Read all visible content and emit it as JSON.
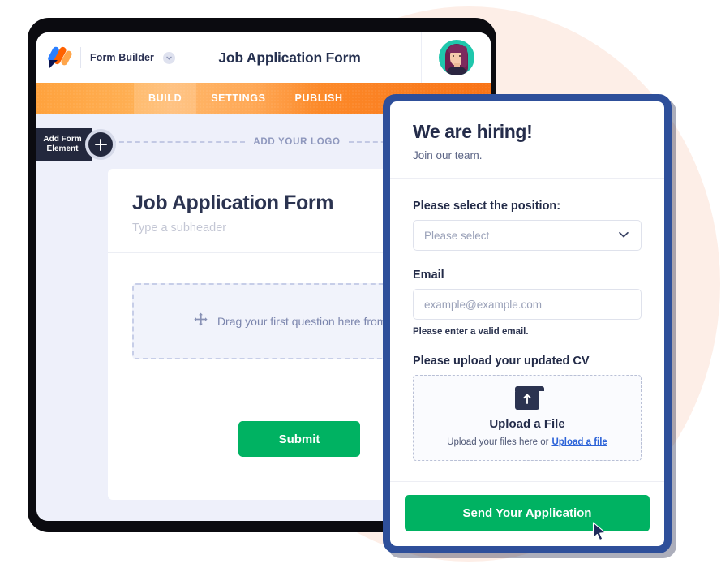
{
  "builder": {
    "brand": {
      "name": "Form Builder",
      "logo_icon": "jotform-logo-icon",
      "chevron_icon": "chevron-down-icon"
    },
    "form_title": "Job Application Form",
    "avatar_icon": "user-avatar",
    "tabs": [
      {
        "label": "BUILD",
        "active": true
      },
      {
        "label": "SETTINGS",
        "active": false
      },
      {
        "label": "PUBLISH",
        "active": false
      }
    ],
    "add_element": {
      "label_line1": "Add Form",
      "label_line2": "Element",
      "plus_icon": "plus-icon"
    },
    "logo_row_label": "ADD YOUR LOGO",
    "canvas": {
      "heading": "Job Application Form",
      "subheading": "Type a subheader",
      "drop_zone_label": "Drag your first question here from left",
      "drop_zone_icon": "move-arrows-icon",
      "submit_label": "Submit"
    }
  },
  "preview": {
    "title": "We are hiring!",
    "subtitle": "Join our team.",
    "fields": {
      "position": {
        "label": "Please select the position:",
        "value": "Please select",
        "chevron_icon": "chevron-down-icon"
      },
      "email": {
        "label": "Email",
        "placeholder": "example@example.com",
        "value": "",
        "error": "Please enter a valid email."
      },
      "cv": {
        "label": "Please upload your updated CV",
        "icon": "folder-upload-icon",
        "title": "Upload a File",
        "hint": "Upload your files here or",
        "link": "Upload a file"
      }
    },
    "submit_label": "Send Your Application"
  },
  "colors": {
    "green": "#00b262",
    "orange": "#f97316",
    "navy": "#2e4f9a",
    "peach": "#fdeee7",
    "link": "#2c63d8"
  }
}
